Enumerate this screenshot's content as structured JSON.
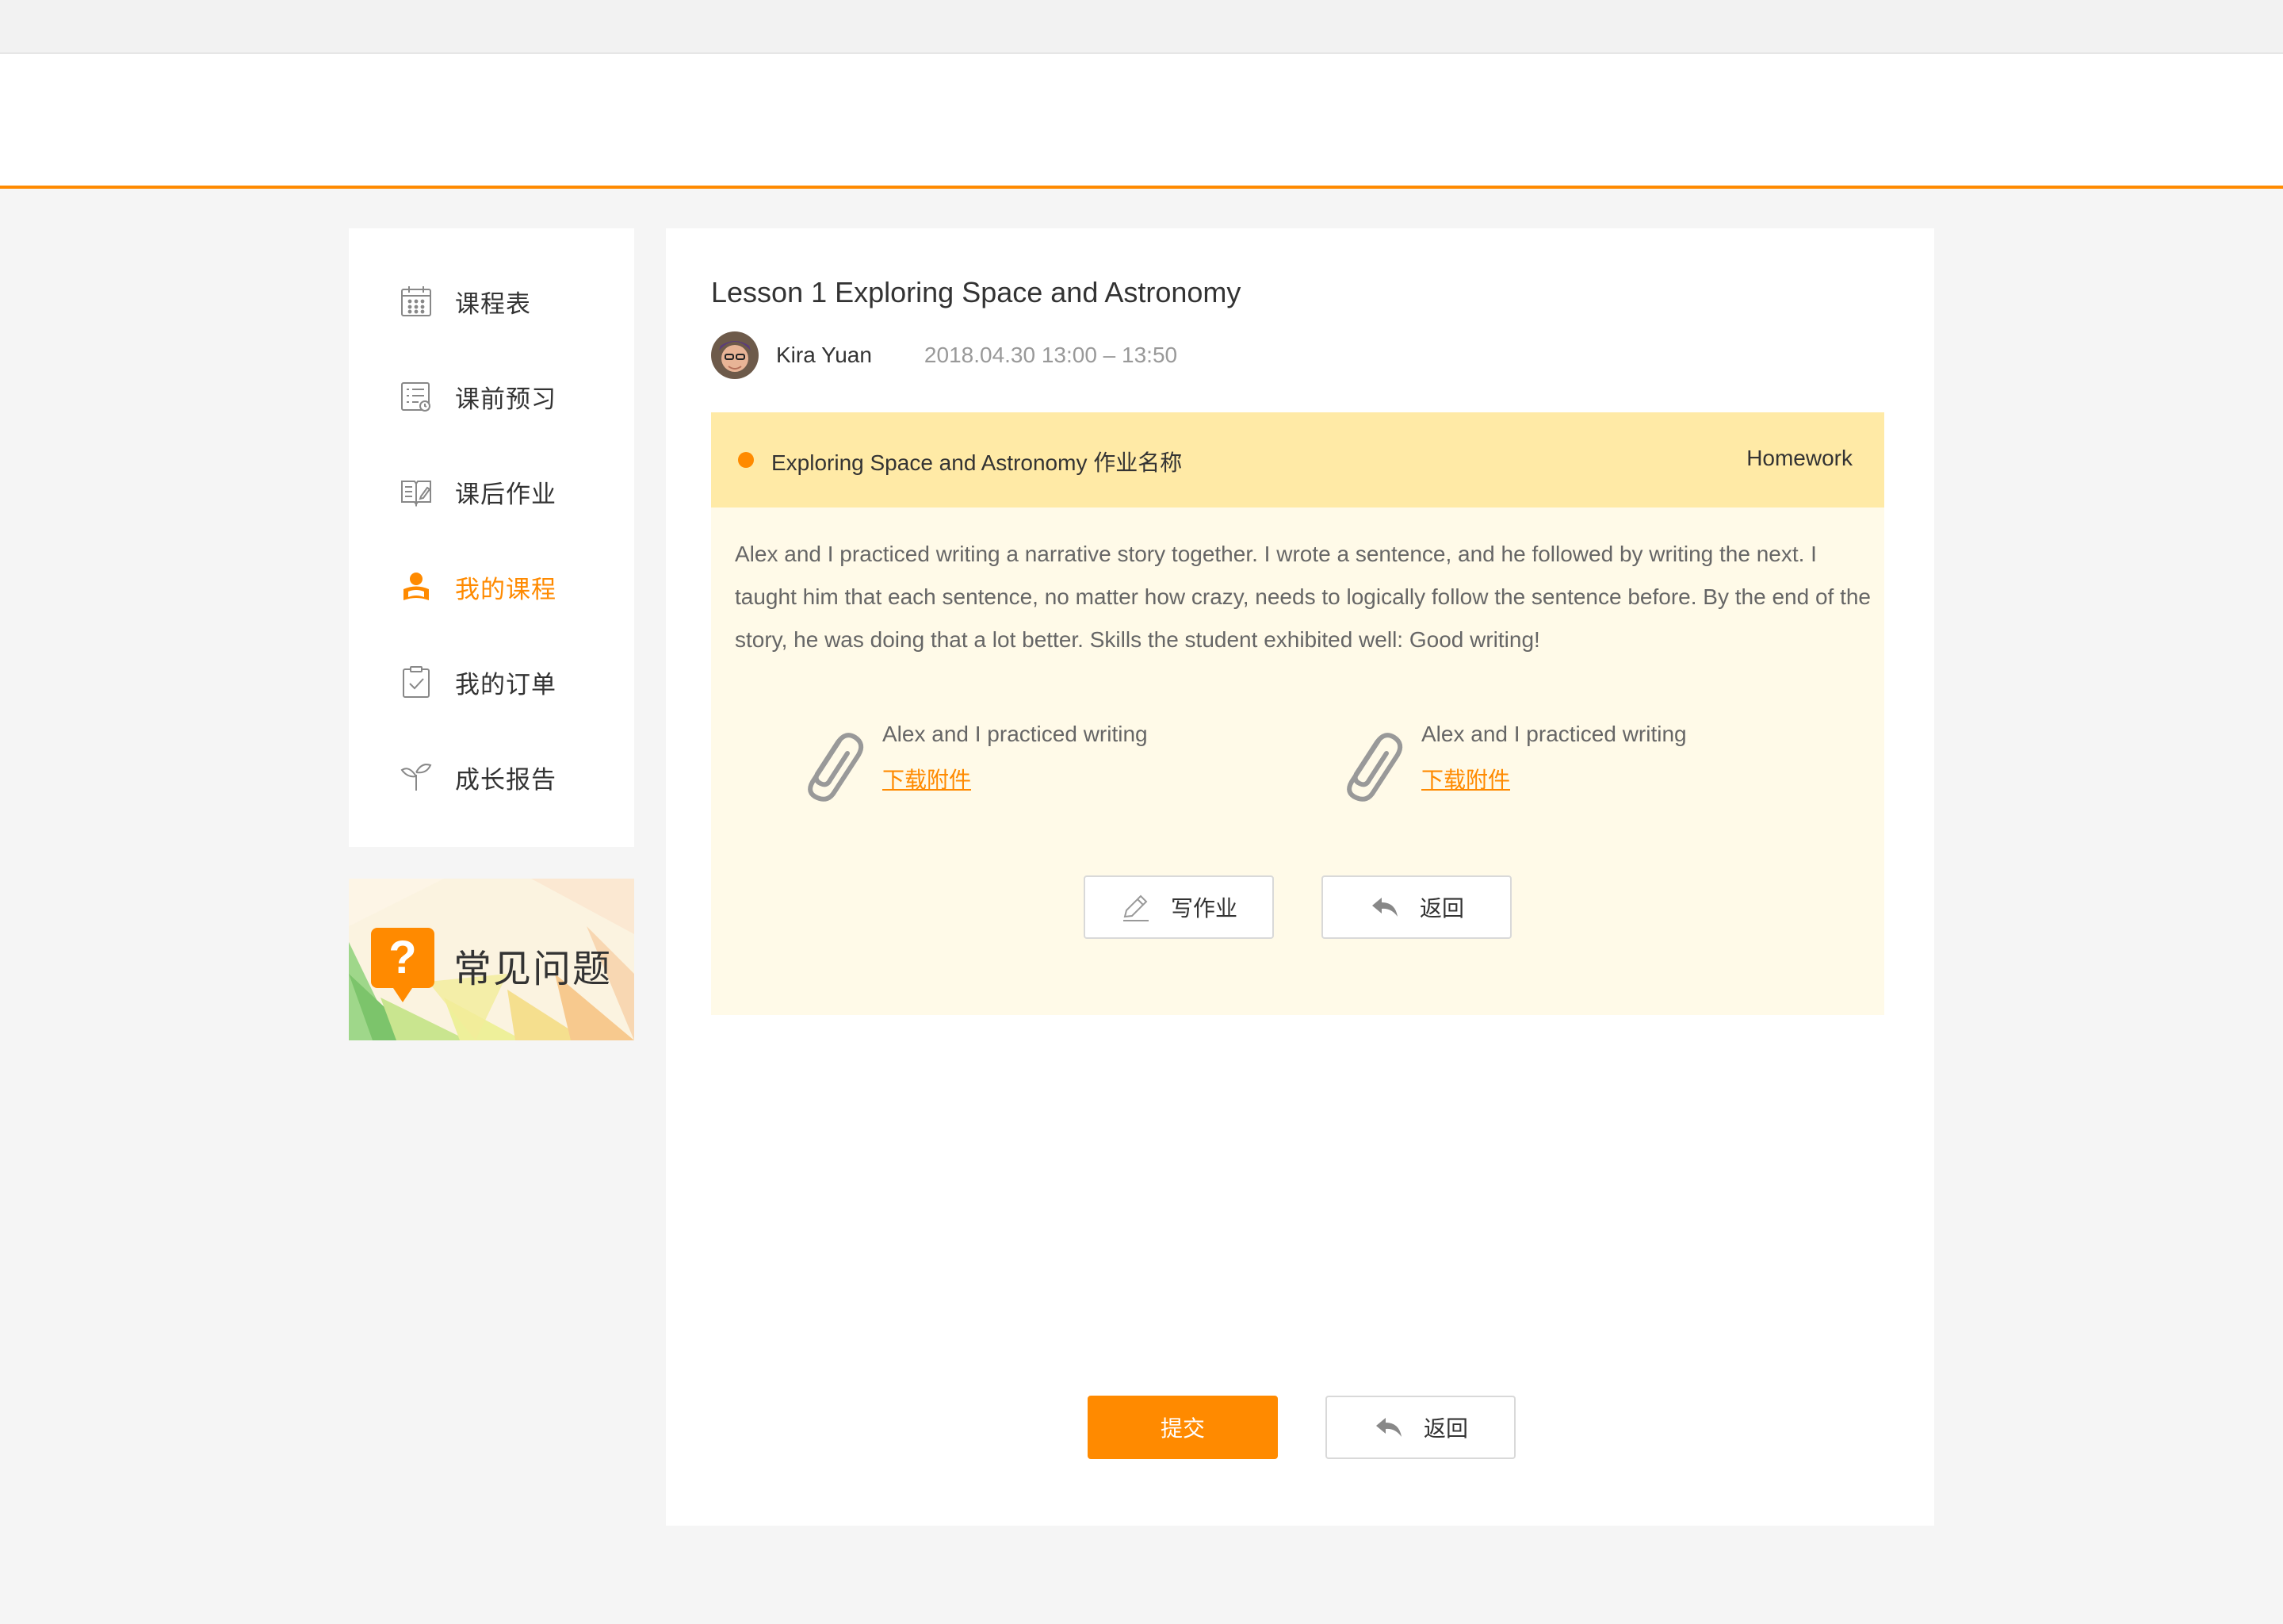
{
  "sidebar": {
    "items": [
      {
        "label": "课程表",
        "icon": "calendar-icon"
      },
      {
        "label": "课前预习",
        "icon": "checklist-icon"
      },
      {
        "label": "课后作业",
        "icon": "book-edit-icon"
      },
      {
        "label": "我的课程",
        "icon": "user-book-icon"
      },
      {
        "label": "我的订单",
        "icon": "clipboard-check-icon"
      },
      {
        "label": "成长报告",
        "icon": "sprout-icon"
      }
    ],
    "active_index": 3
  },
  "faq": {
    "label": "常见问题",
    "icon": "question-bubble-icon"
  },
  "lesson": {
    "title": "Lesson 1 Exploring Space and Astronomy",
    "teacher": "Kira Yuan",
    "time": "2018.04.30 13:00 – 13:50"
  },
  "homework": {
    "name": "Exploring Space and Astronomy 作业名称",
    "type": "Homework",
    "description": "Alex and I practiced writing a narrative story together. I wrote a sentence, and he followed by writing the next. I taught him that each sentence, no matter how crazy, needs to logically follow the sentence before. By the end of the story, he was doing that a lot better. Skills the student exhibited well: Good writing!",
    "attachments": [
      {
        "name": "Alex and I practiced writing",
        "link": "下载附件",
        "icon": "paperclip-icon"
      },
      {
        "name": "Alex and I practiced writing",
        "link": "下载附件",
        "icon": "paperclip-icon"
      }
    ],
    "write_label": "写作业",
    "back_label": "返回"
  },
  "footer": {
    "submit_label": "提交",
    "back_label": "返回"
  },
  "colors": {
    "accent": "#ff8a00",
    "card_header": "#ffeaa6",
    "card_body": "#fffae8"
  }
}
